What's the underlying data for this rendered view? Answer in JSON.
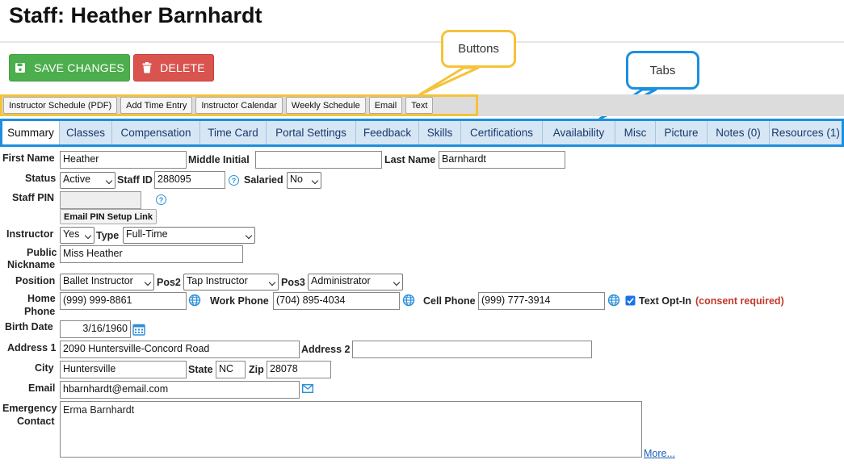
{
  "page": {
    "title": "Staff: Heather Barnhardt"
  },
  "actions": {
    "save_label": "SAVE CHANGES",
    "delete_label": "DELETE"
  },
  "annotations": {
    "buttons": "Buttons",
    "tabs": "Tabs"
  },
  "colors": {
    "save": "#4cae4c",
    "delete": "#d9534f",
    "callout_buttons": "#f5c23a",
    "callout_tabs": "#1b8fe0",
    "link": "#1a5fb4",
    "consent": "#c0392b"
  },
  "toolbar": [
    "Instructor Schedule (PDF)",
    "Add Time Entry",
    "Instructor Calendar",
    "Weekly Schedule",
    "Email",
    "Text"
  ],
  "tabs": [
    "Summary",
    "Classes",
    "Compensation",
    "Time Card",
    "Portal Settings",
    "Feedback",
    "Skills",
    "Certifications",
    "Availability",
    "Misc",
    "Picture",
    "Notes (0)",
    "Resources (1)"
  ],
  "active_tab": "Summary",
  "form": {
    "first_name_label": "First Name",
    "first_name": "Heather",
    "middle_initial_label": "Middle Initial",
    "middle_initial": "",
    "last_name_label": "Last Name",
    "last_name": "Barnhardt",
    "status_label": "Status",
    "status": "Active",
    "staff_id_label": "Staff ID",
    "staff_id": "288095",
    "salaried_label": "Salaried",
    "salaried": "No",
    "staff_pin_label": "Staff PIN",
    "email_pin_button": "Email PIN Setup Link",
    "instructor_label": "Instructor",
    "instructor": "Yes",
    "type_label": "Type",
    "type": "Full-Time",
    "public_label": "Public",
    "nickname_label": "Nickname",
    "nickname": "Miss Heather",
    "position_label": "Position",
    "position": "Ballet Instructor",
    "pos2_label": "Pos2",
    "pos2": "Tap Instructor",
    "pos3_label": "Pos3",
    "pos3": "Administrator",
    "home_label": "Home",
    "phone_label": "Phone",
    "home_phone": "(999) 999-8861",
    "work_phone_label": "Work Phone",
    "work_phone": "(704) 895-4034",
    "cell_phone_label": "Cell Phone",
    "cell_phone": "(999) 777-3914",
    "text_optin_label": "Text Opt-In",
    "consent_label": "(consent required)",
    "birth_date_label": "Birth Date",
    "birth_date": "3/16/1960",
    "address1_label": "Address 1",
    "address1": "2090 Huntersville-Concord Road",
    "address2_label": "Address 2",
    "address2": "",
    "city_label": "City",
    "city": "Huntersville",
    "state_label": "State",
    "state": "NC",
    "zip_label": "Zip",
    "zip": "28078",
    "email_label": "Email",
    "email": "hbarnhardt@email.com",
    "emergency_label": "Emergency",
    "contact_label": "Contact",
    "emergency_contact": "Erma Barnhardt",
    "more_link": "More..."
  },
  "icons": {
    "save": "floppy-disk-icon",
    "delete": "trash-icon",
    "help": "question-circle-icon",
    "globe": "globe-icon",
    "calendar": "calendar-icon",
    "mail": "envelope-icon",
    "checkbox": "checkbox-checked"
  }
}
